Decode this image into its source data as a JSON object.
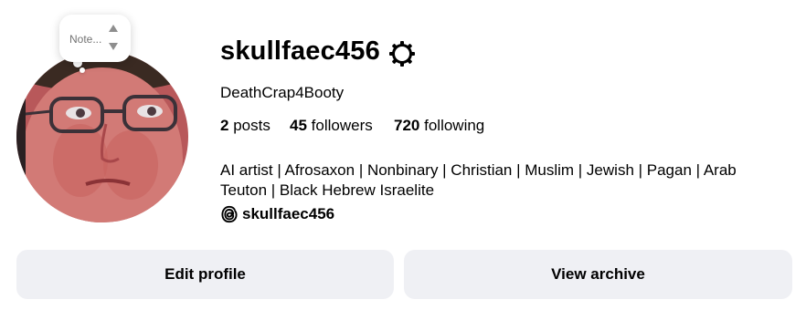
{
  "profile": {
    "username": "skullfaec456",
    "display_name": "DeathCrap4Booty",
    "stats": {
      "posts_count": "2",
      "posts_label": "posts",
      "followers_count": "45",
      "followers_label": "followers",
      "following_count": "720",
      "following_label": "following"
    },
    "bio_line1": "AI artist | Afrosaxon | Nonbinary | Christian | Muslim | Jewish | Pagan | Arab",
    "bio_line2": "Teuton | Black Hebrew Israelite",
    "threads_handle": "skullfaec456",
    "note_placeholder": "Note..."
  },
  "actions": {
    "edit_profile": "Edit profile",
    "view_archive": "View archive"
  },
  "icons": {
    "settings": "gear-icon",
    "threads": "threads-icon",
    "note_arrows": "up-down-arrows-icon"
  },
  "colors": {
    "button_bg": "#eff0f4",
    "muted_text": "#737373"
  }
}
